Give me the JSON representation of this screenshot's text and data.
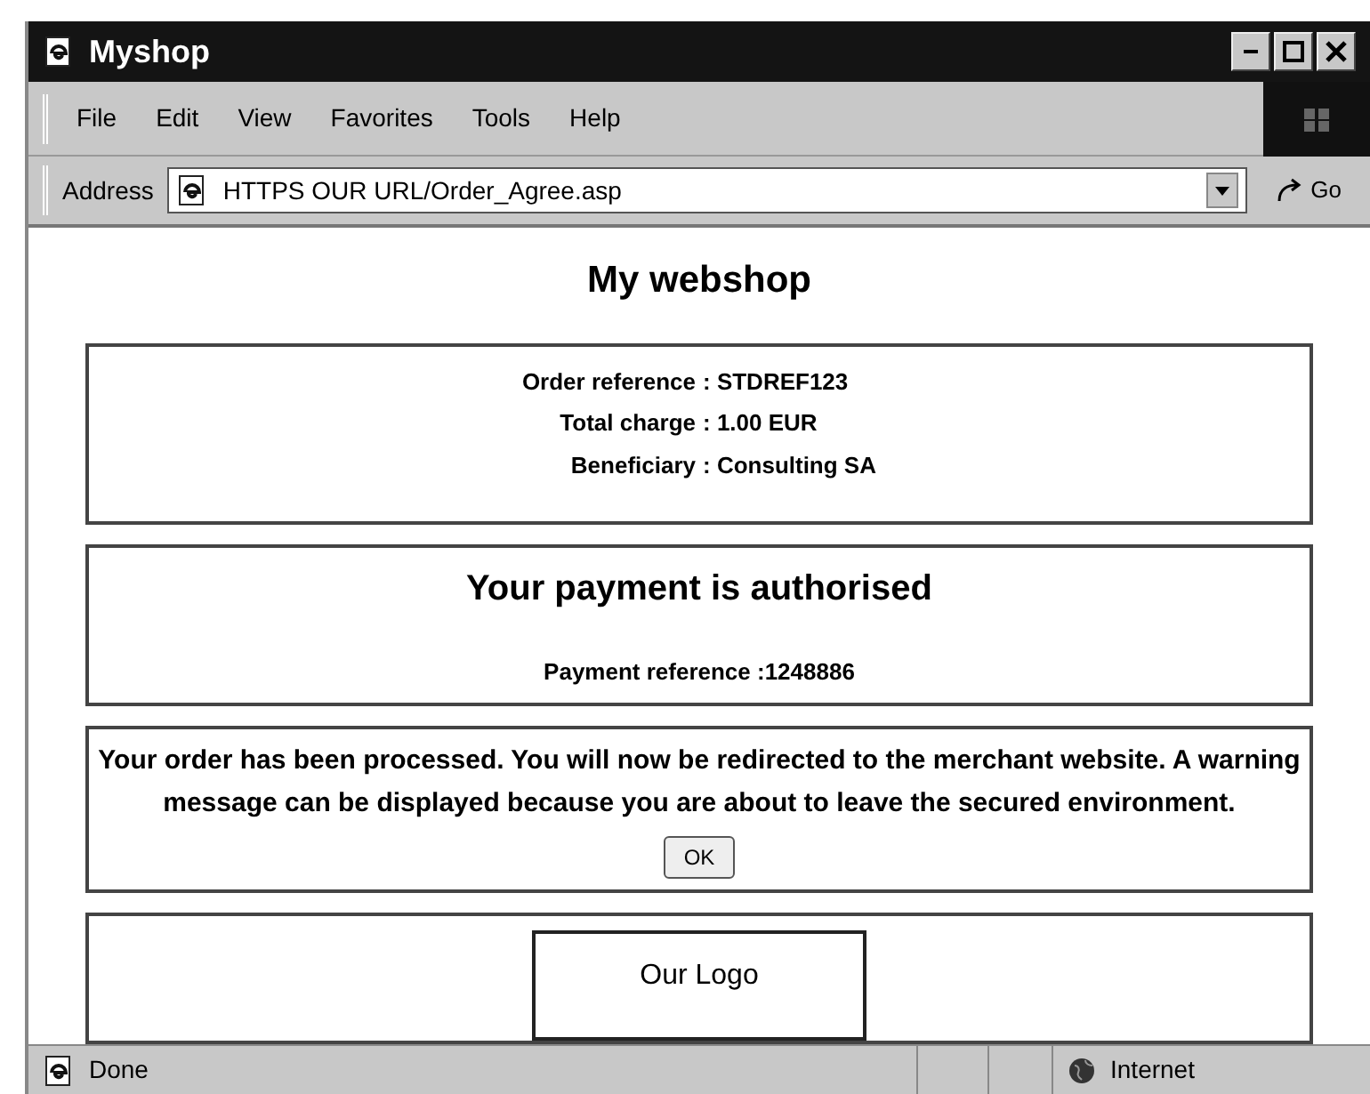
{
  "window": {
    "title": "Myshop"
  },
  "menu": [
    "File",
    "Edit",
    "View",
    "Favorites",
    "Tools",
    "Help"
  ],
  "address": {
    "label": "Address",
    "value": "HTTPS OUR URL/Order_Agree.asp",
    "go": "Go"
  },
  "page": {
    "heading": "My webshop",
    "details": [
      {
        "label": "Order reference",
        "value": ": STDREF123"
      },
      {
        "label": "Total charge",
        "value": ": 1.00 EUR"
      },
      {
        "label": "Beneficiary",
        "value": ": Consulting SA"
      }
    ],
    "status_title": "Your payment is authorised",
    "payment_reference": "Payment reference :1248886",
    "message": "Your order has been processed. You will now be redirected to the merchant website. A warning message can be displayed because you are about to leave the secured environment.",
    "ok_button": "OK",
    "logo": "Our Logo"
  },
  "status_bar": {
    "text": "Done",
    "zone": "Internet"
  }
}
